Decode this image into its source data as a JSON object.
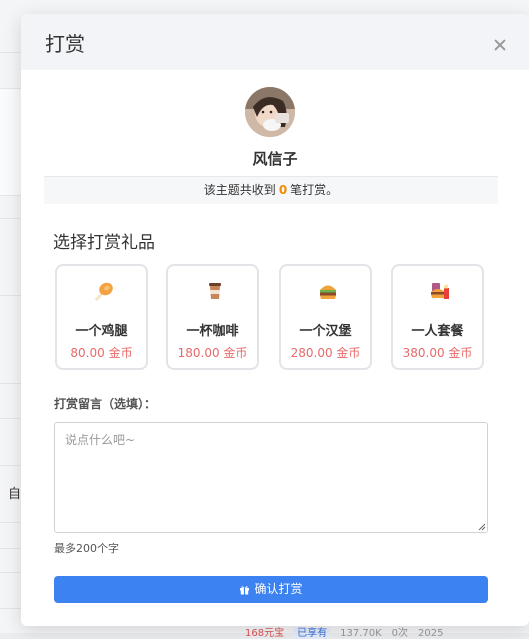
{
  "modal": {
    "title": "打赏"
  },
  "recipient": {
    "name": "风信子",
    "received_prefix": "该主题共收到",
    "received_count": "0",
    "received_suffix": "笔打赏。"
  },
  "gift_section_title": "选择打赏礼品",
  "gifts": [
    {
      "name": "一个鸡腿",
      "price": "80.00 金币",
      "icon": "chicken-leg-icon"
    },
    {
      "name": "一杯咖啡",
      "price": "180.00 金币",
      "icon": "coffee-icon"
    },
    {
      "name": "一个汉堡",
      "price": "280.00 金币",
      "icon": "hamburger-icon"
    },
    {
      "name": "一人套餐",
      "price": "380.00 金币",
      "icon": "meal-combo-icon"
    }
  ],
  "message": {
    "label": "打赏留言（选填）：",
    "placeholder": "说点什么吧~",
    "value": "",
    "limit": "最多200个字"
  },
  "confirm_label": "确认打赏",
  "background": {
    "left_text": "自",
    "row": [
      "168元宝",
      "已享有",
      "137.70K",
      "0次",
      "2025"
    ]
  },
  "colors": {
    "accent": "#3c82f0",
    "price": "#e86a6a",
    "count": "#f08c00"
  }
}
